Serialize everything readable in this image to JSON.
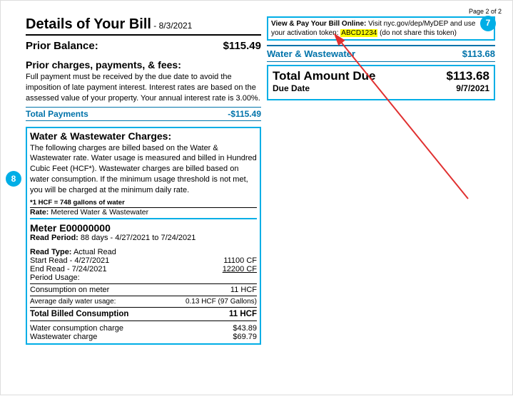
{
  "pagenum": "Page 2 of 2",
  "title": "Details of Your Bill",
  "title_date": " - 8/3/2021",
  "prior_balance_label": "Prior Balance:",
  "prior_balance_value": "$115.49",
  "pcf": {
    "heading": "Prior charges, payments, & fees:",
    "text": "Full payment must be received by the due date to avoid the imposition of late payment interest. Interest rates are based on the assessed value of your property. Your annual interest rate is 3.00%."
  },
  "total_payments_label": "Total Payments",
  "total_payments_value": "-$115.49",
  "ww": {
    "heading": "Water & Wastewater Charges:",
    "text": "The following charges are billed based on the Water & Wastewater rate.  Water usage is measured and billed in Hundred Cubic Feet (HCF*).  Wastewater charges are billed based on water consumption.  If the minimum usage threshold is not met, you will be charged at the minimum daily rate.",
    "footnote": "*1 HCF = 748 gallons of water",
    "rate_label": "Rate:",
    "rate_value": "Metered Water & Wastewater"
  },
  "meter": {
    "name": "Meter E00000000",
    "read_period_label": "Read Period:",
    "read_period_value": "88 days - 4/27/2021 to 7/24/2021",
    "read_type_label": "Read Type:",
    "read_type_value": "Actual Read",
    "start_read_label": "Start Read - 4/27/2021",
    "start_read_value": "11100 CF",
    "end_read_label": "End Read - 7/24/2021",
    "end_read_value": "12200 CF",
    "period_usage_label": "Period Usage:",
    "cons_meter_label": "Consumption on meter",
    "cons_meter_value": "11 HCF",
    "avg_label": "Average daily water usage:",
    "avg_value": "0.13 HCF (97 Gallons)",
    "total_cons_label": "Total Billed Consumption",
    "total_cons_value": "11 HCF",
    "water_charge_label": "Water consumption charge",
    "water_charge_value": "$43.89",
    "wastewater_charge_label": "Wastewater charge",
    "wastewater_charge_value": "$69.79"
  },
  "online": {
    "bold": "View & Pay Your Bill Online:",
    "text1": " Visit nyc.gov/dep/MyDEP and use your activation token: ",
    "token": "ABCD1234",
    "text2": " (do not share this token)"
  },
  "summary": {
    "ww_label": "Water & Wastewater",
    "ww_value": "$113.68",
    "tad_label": "Total Amount Due",
    "tad_value": "$113.68",
    "due_label": "Due Date",
    "due_value": "9/7/2021"
  },
  "badges": {
    "b7": "7",
    "b8": "8"
  }
}
